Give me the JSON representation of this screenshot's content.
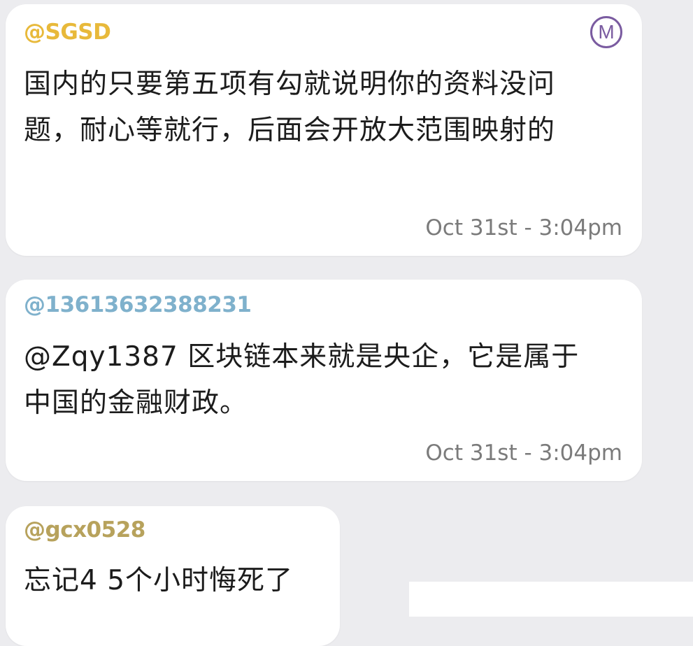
{
  "colors": {
    "background": "#ececef",
    "bubble": "#ffffff",
    "user_sgsd": "#e8b93a",
    "user_phone": "#7fb1cc",
    "user_gcx": "#b7a25c",
    "badge": "#7a5ba0",
    "timestamp": "#7b7b7b"
  },
  "messages": [
    {
      "username": "@SGSD",
      "text": "国内的只要第五项有勾就说明你的资料没问题，耐心等就行，后面会开放大范围映射的",
      "timestamp": "Oct 31st - 3:04pm",
      "badge": "M",
      "badge_icon": "m-circle-icon"
    },
    {
      "username": "@13613632388231",
      "text": "@Zqy1387 区块链本来就是央企，它是属于中国的金融财政。",
      "timestamp": "Oct 31st - 3:04pm"
    },
    {
      "username": "@gcx0528",
      "text": "忘记4 5个小时悔死了"
    }
  ]
}
